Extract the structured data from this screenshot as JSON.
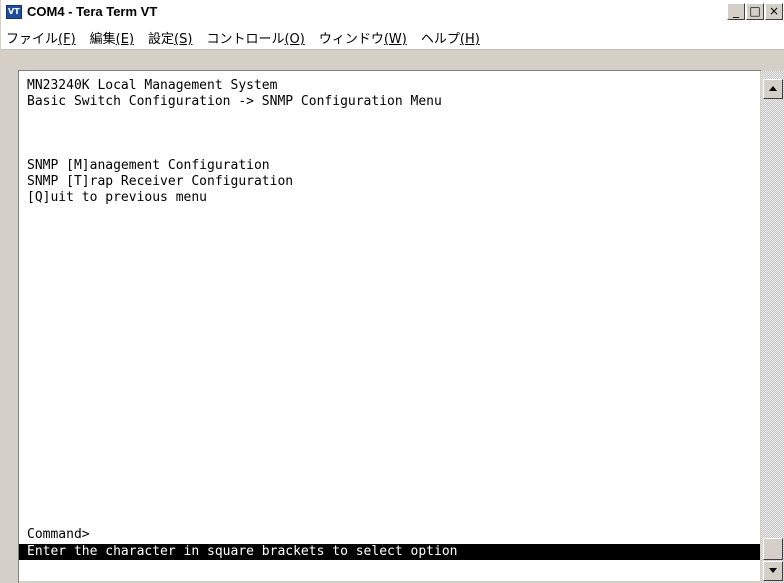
{
  "window": {
    "title": "COM4 - Tera Term VT",
    "buttons": {
      "minimize": "_",
      "maximize": "□",
      "close": "×"
    }
  },
  "menu": [
    {
      "label": "ファイル",
      "accel": "(F)"
    },
    {
      "label": "編集",
      "accel": "(E)"
    },
    {
      "label": "設定",
      "accel": "(S)"
    },
    {
      "label": "コントロール",
      "accel": "(O)"
    },
    {
      "label": "ウィンドウ",
      "accel": "(W)"
    },
    {
      "label": "ヘルプ",
      "accel": "(H)"
    }
  ],
  "terminal": {
    "lines": [
      "MN23240K Local Management System",
      "Basic Switch Configuration -> SNMP Configuration Menu",
      "",
      "",
      "SNMP [M]anagement Configuration",
      "SNMP [T]rap Receiver Configuration",
      "[Q]uit to previous menu"
    ],
    "prompt": "Command>",
    "status": "Enter the character in square brackets to select option"
  },
  "colors": {
    "terminal_bg": "#ffffff",
    "terminal_fg": "#000000",
    "status_bg": "#000000",
    "status_fg": "#ffffff",
    "chrome": "#d4d0c8"
  }
}
